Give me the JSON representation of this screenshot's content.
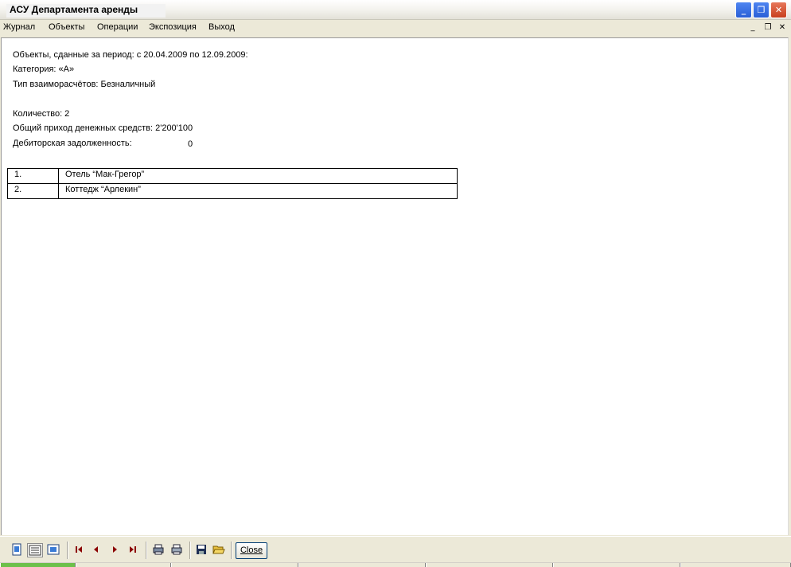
{
  "window": {
    "title": "АСУ Департамента аренды"
  },
  "titlebar_buttons": {
    "minimize": "_",
    "maximize": "❐",
    "close": "✕"
  },
  "menu": [
    "Журнал",
    "Объекты",
    "Операции",
    "Экспозиция",
    "Выход"
  ],
  "mdi_controls": {
    "minimize": "_",
    "restore": "❐",
    "close": "✕"
  },
  "report": {
    "period": "Объекты, сданные за период: с 20.04.2009 по 12.09.2009:",
    "category": "Категория: «А»",
    "payment_type": "Тип взаиморасчётов: Безналичный",
    "count": "Количество: 2",
    "income": "Общий приход денежных средств: 2'200'100",
    "debt_label": "Дебиторская задолженность:",
    "debt_value": "0",
    "rows": [
      {
        "num": "1.",
        "name": "Отель “Мак-Грегор”"
      },
      {
        "num": "2.",
        "name": "Коттедж “Арлекин”"
      }
    ]
  },
  "toolbar": {
    "icons": [
      "one-page-icon",
      "page-width-icon",
      "full-page-icon",
      "first-page-icon",
      "prev-page-icon",
      "next-page-icon",
      "last-page-icon",
      "print-setup-icon",
      "print-icon",
      "save-icon",
      "open-icon"
    ],
    "close_label": "Close"
  },
  "colors": {
    "titlebar_close": "#c8401f",
    "titlebar_button": "#2a5fd6",
    "nav_arrows": "#8b0000"
  }
}
